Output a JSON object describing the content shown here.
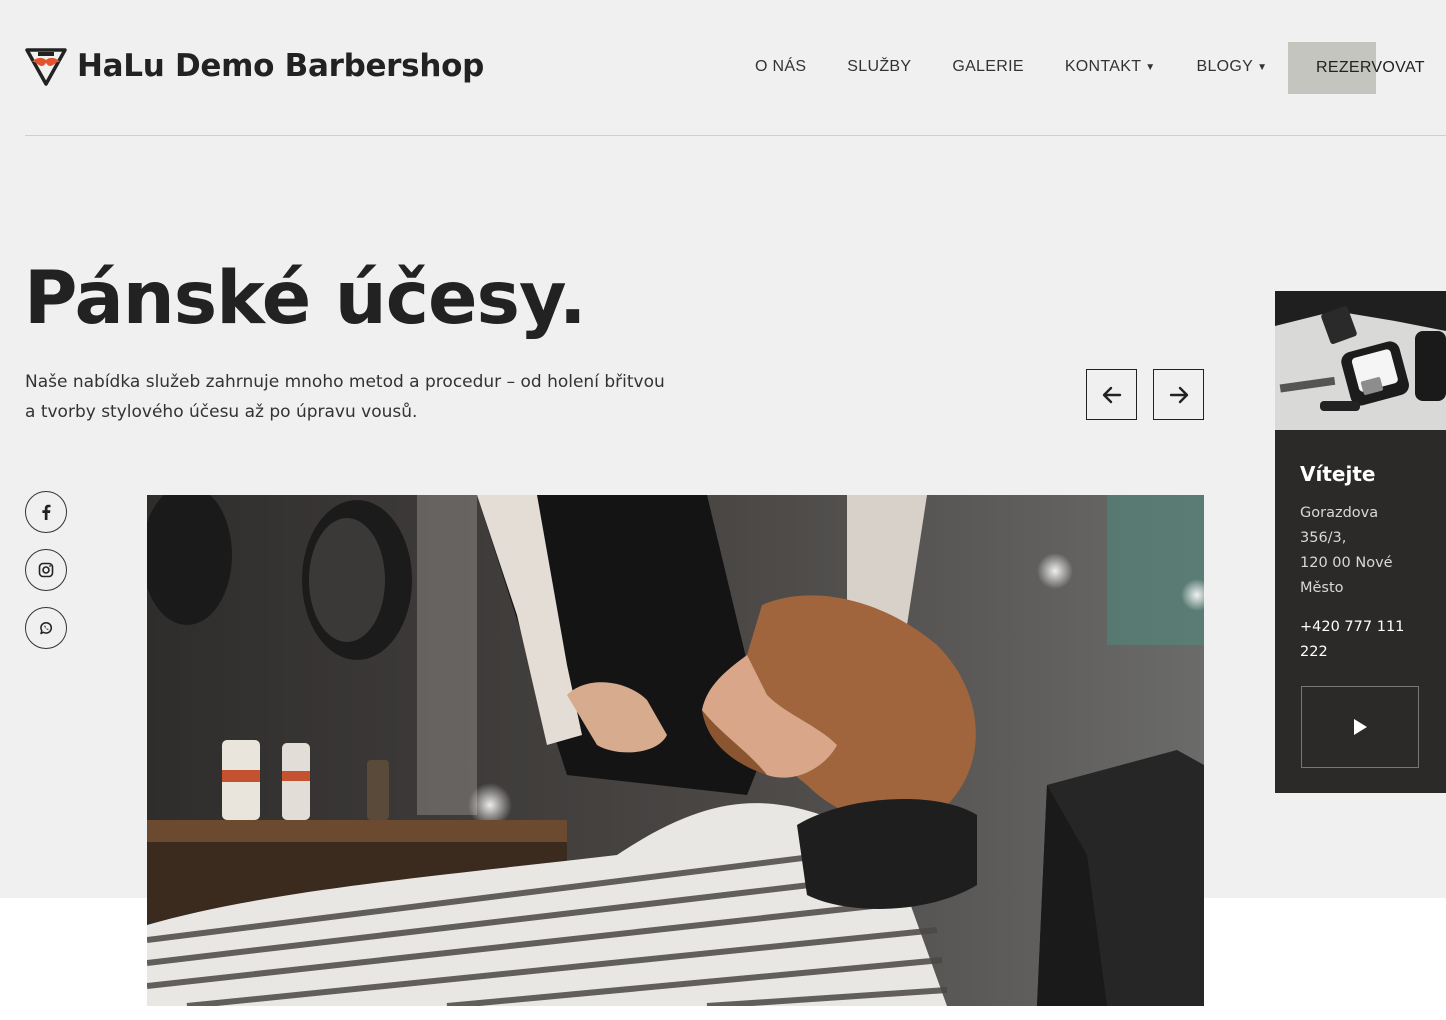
{
  "brand": {
    "name": "HaLu Demo Barbershop",
    "accent_color": "#e0552e"
  },
  "nav": {
    "items": [
      "O NÁS",
      "SLUŽBY",
      "GALERIE",
      "KONTAKT",
      "BLOGY"
    ],
    "reserve_label": "REZERVOVAT"
  },
  "hero": {
    "title": "Pánské účesy.",
    "intro_line1": "Naše nabídka služeb zahrnuje mnoho metod a procedur – od holení břitvou",
    "intro_line2": "a tvorby stylového účesu až po úpravu vousů."
  },
  "social": {
    "icons": [
      "facebook-icon",
      "instagram-icon",
      "whatsapp-icon"
    ]
  },
  "card": {
    "title": "Vítejte",
    "address_lines": [
      "Gorazdova",
      "356/3,",
      "120 00 Nové",
      "Město"
    ],
    "phone_lines": [
      "+420 777 111",
      "222"
    ]
  },
  "colors": {
    "background": "#f0f0f0",
    "card_bg": "#2b2a29",
    "reserve_highlight": "#c5c5bf"
  }
}
